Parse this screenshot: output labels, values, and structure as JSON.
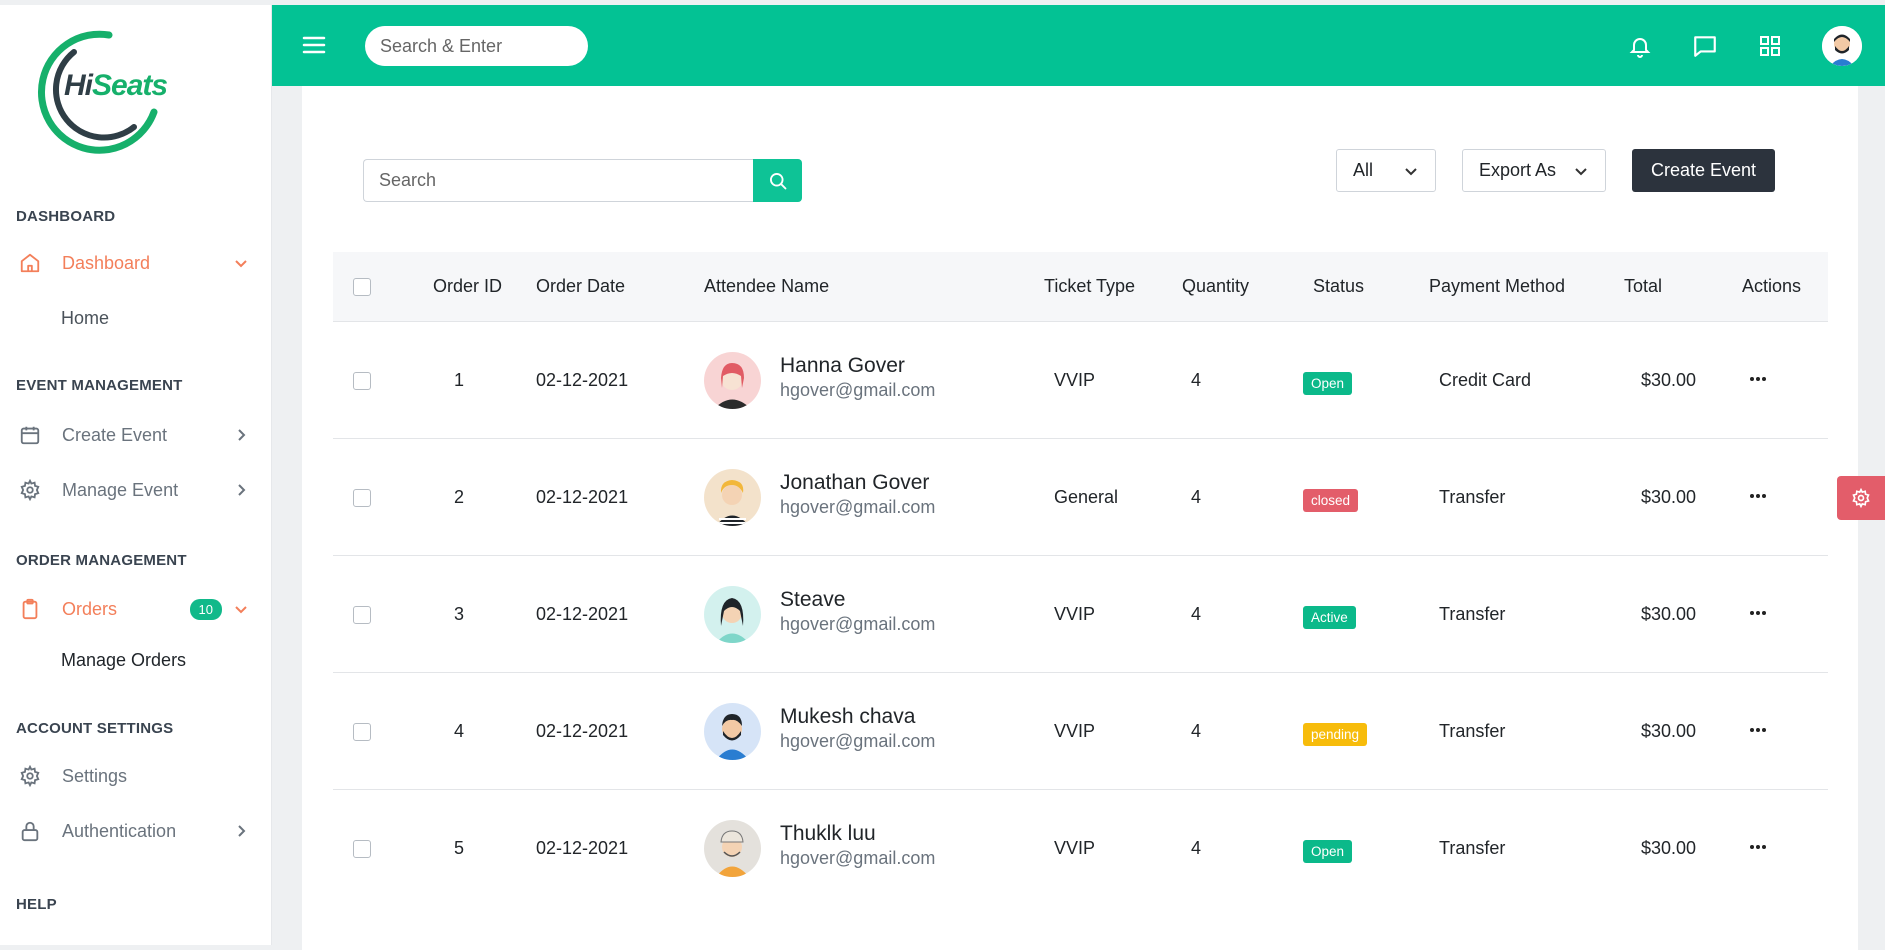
{
  "brand": {
    "hi": "Hi",
    "seats": "Seats",
    "accent": "#03c294"
  },
  "topbar": {
    "search_placeholder": "Search & Enter"
  },
  "sidebar": {
    "sections": {
      "dashboard": "DASHBOARD",
      "event_management": "EVENT MANAGEMENT",
      "order_management": "ORDER MANAGEMENT",
      "account_settings": "ACCOUNT SETTINGS",
      "help": "HELP"
    },
    "items": {
      "dashboard": "Dashboard",
      "home": "Home",
      "create_event": "Create Event",
      "manage_event": "Manage Event",
      "orders": "Orders",
      "orders_count": "10",
      "manage_orders": "Manage Orders",
      "settings": "Settings",
      "authentication": "Authentication"
    }
  },
  "toolbar": {
    "search_placeholder": "Search",
    "filter_value": "All",
    "export_label": "Export As",
    "create_label": "Create Event"
  },
  "table": {
    "headers": {
      "order_id": "Order ID",
      "order_date": "Order Date",
      "attendee": "Attendee Name",
      "ticket_type": "Ticket Type",
      "quantity": "Quantity",
      "status": "Status",
      "payment": "Payment Method",
      "total": "Total",
      "actions": "Actions"
    },
    "rows": [
      {
        "id": "1",
        "date": "02-12-2021",
        "name": "Hanna Gover",
        "email": "hgover@gmail.com",
        "ticket": "VVIP",
        "qty": "4",
        "status": "Open",
        "payment": "Credit Card",
        "total": "$30.00"
      },
      {
        "id": "2",
        "date": "02-12-2021",
        "name": "Jonathan Gover",
        "email": "hgover@gmail.com",
        "ticket": "General",
        "qty": "4",
        "status": "closed",
        "payment": "Transfer",
        "total": "$30.00"
      },
      {
        "id": "3",
        "date": "02-12-2021",
        "name": "Steave",
        "email": "hgover@gmail.com",
        "ticket": "VVIP",
        "qty": "4",
        "status": "Active",
        "payment": "Transfer",
        "total": "$30.00"
      },
      {
        "id": "4",
        "date": "02-12-2021",
        "name": "Mukesh chava",
        "email": "hgover@gmail.com",
        "ticket": "VVIP",
        "qty": "4",
        "status": "pending",
        "payment": "Transfer",
        "total": "$30.00"
      },
      {
        "id": "5",
        "date": "02-12-2021",
        "name": "Thuklk luu",
        "email": "hgover@gmail.com",
        "ticket": "VVIP",
        "qty": "4",
        "status": "Open",
        "payment": "Transfer",
        "total": "$30.00"
      }
    ]
  },
  "status_colors": {
    "Open": "#0bb98a",
    "closed": "#e35d6a",
    "Active": "#0bb98a",
    "pending": "#f7bc0b"
  }
}
